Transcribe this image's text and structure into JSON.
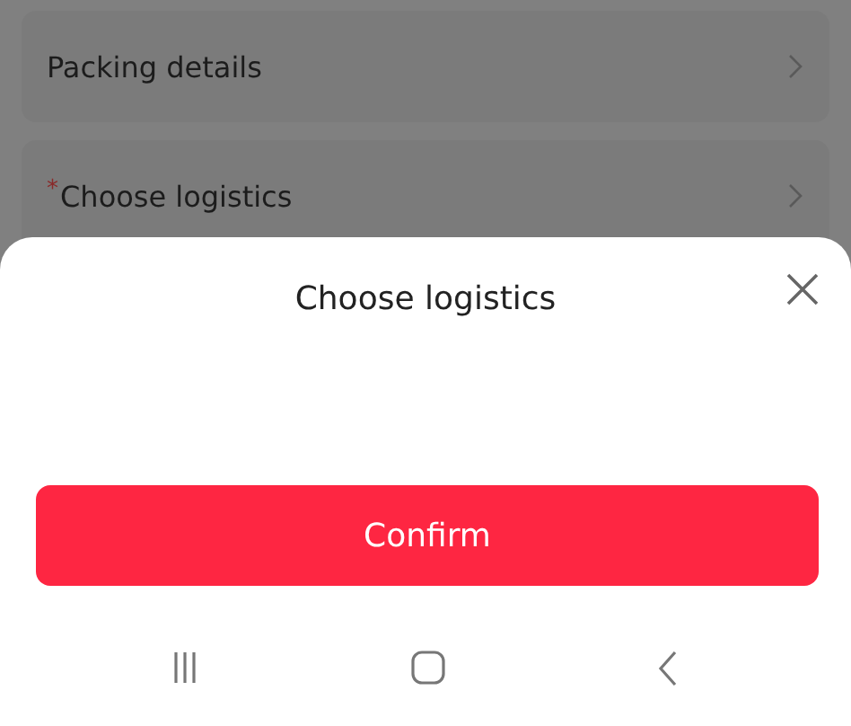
{
  "rows": [
    {
      "label": "Packing details",
      "required_mark": null
    },
    {
      "label": "Choose logistics",
      "required_mark": "*"
    }
  ],
  "sheet": {
    "title": "Choose logistics",
    "confirm_button": "Confirm"
  },
  "nav_bar": {
    "buttons": [
      {
        "kind": "recents"
      },
      {
        "kind": "home"
      },
      {
        "kind": "back"
      }
    ]
  }
}
